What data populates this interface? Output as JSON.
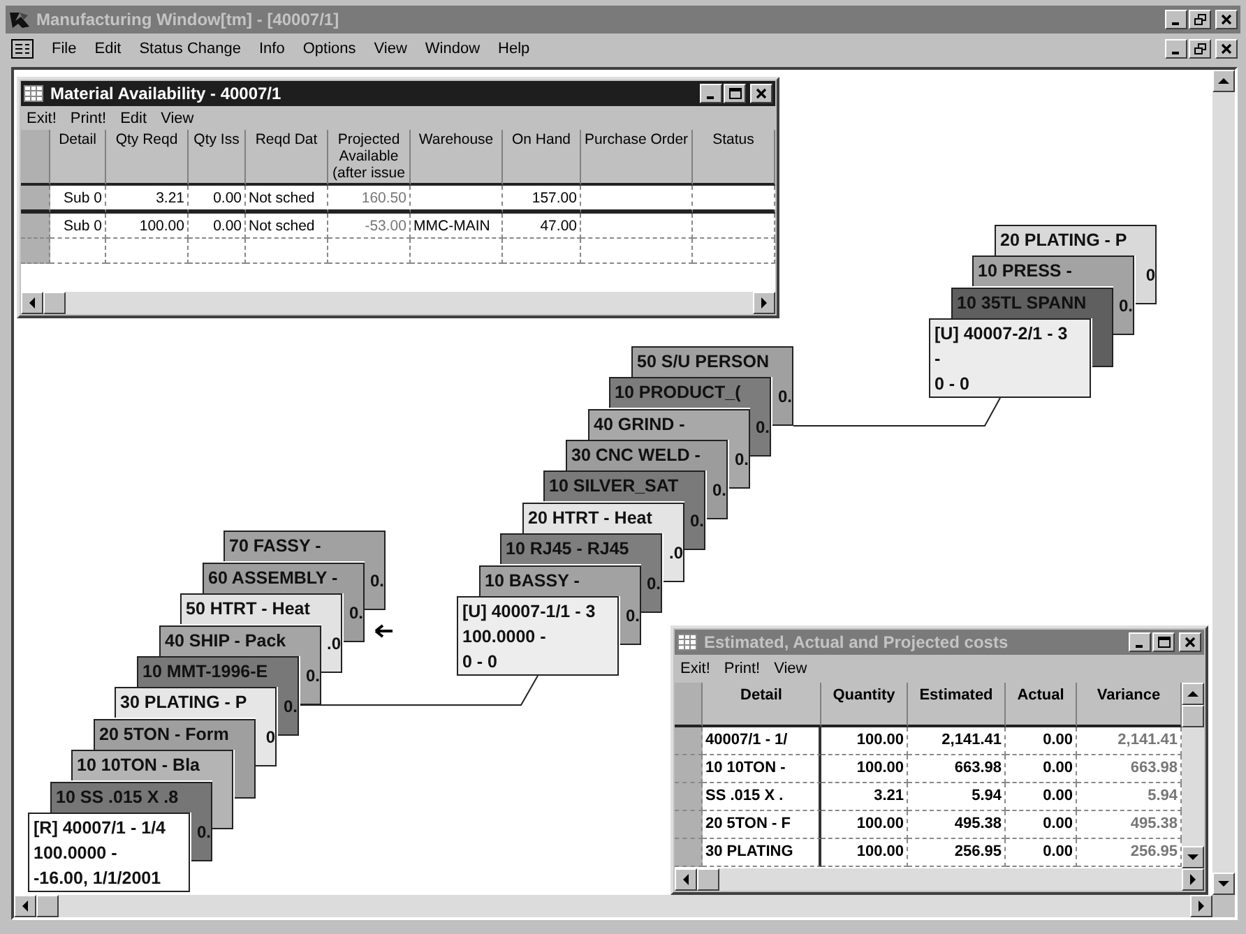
{
  "window": {
    "title": "Manufacturing Window[tm] - [40007/1]",
    "active": false
  },
  "menu": [
    "File",
    "Edit",
    "Status Change",
    "Info",
    "Options",
    "View",
    "Window",
    "Help"
  ],
  "material_window": {
    "title": "Material Availability - 40007/1",
    "active": true,
    "menu": [
      "Exit!",
      "Print!",
      "Edit",
      "View"
    ],
    "columns": [
      "Detail",
      "Qty Reqd",
      "Qty Iss",
      "Reqd Dat",
      "Projected Available (after issue",
      "Warehouse",
      "On Hand",
      "Purchase Order",
      "Status"
    ],
    "rows": [
      [
        "Sub 0",
        "3.21",
        "0.00",
        "Not sched",
        "160.50",
        null,
        "157.00"
      ],
      [
        "Sub 0",
        "100.00",
        "0.00",
        "Not sched",
        "-53.00",
        "MMC-MAIN",
        "47.00"
      ]
    ]
  },
  "stacks": [
    {
      "cards": [
        {
          "lines": [
            "20 PLATING - P"
          ],
          "tail": "0",
          "color": "#d9d9d9"
        },
        {
          "lines": [
            "10 PRESS -"
          ],
          "tail": "0.",
          "color": "#a3a3a3"
        },
        {
          "lines": [
            "10 35TL SPANN"
          ],
          "color": "#5f5f5f"
        },
        {
          "lines": [
            "[U] 40007-2/1 - 3",
            "-",
            "0 - 0"
          ],
          "color": "#ececec"
        }
      ]
    },
    {
      "cards": [
        {
          "lines": [
            "50 S/U PERSON"
          ],
          "tail": "0.",
          "color": "#a0a0a0"
        },
        {
          "lines": [
            "10 PRODUCT_("
          ],
          "tail": "0.",
          "color": "#7c7c7c"
        },
        {
          "lines": [
            "40 GRIND -"
          ],
          "tail": "0.",
          "color": "#a8a8a8"
        },
        {
          "lines": [
            "30 CNC WELD -"
          ],
          "tail": "0.",
          "color": "#9c9c9c"
        },
        {
          "lines": [
            "10 SILVER_SAT"
          ],
          "tail": "0.",
          "color": "#7a7a7a"
        },
        {
          "lines": [
            "20 HTRT - Heat"
          ],
          "tail": ".0",
          "color": "#e4e4e4"
        },
        {
          "lines": [
            "10 RJ45 - RJ45"
          ],
          "tail": "0.",
          "color": "#7e7e7e"
        },
        {
          "lines": [
            "10 BASSY -"
          ],
          "tail": "0.",
          "color": "#a2a2a2"
        },
        {
          "lines": [
            "[U] 40007-1/1 - 3",
            "100.0000 -",
            "0 - 0"
          ],
          "color": "#ededed"
        }
      ]
    },
    {
      "cards": [
        {
          "lines": [
            "70 FASSY -"
          ],
          "tail": "0.",
          "color": "#a1a1a1"
        },
        {
          "lines": [
            "60 ASSEMBLY -"
          ],
          "tail": "0.",
          "color": "#9d9d9d"
        },
        {
          "lines": [
            "50 HTRT - Heat"
          ],
          "tail": ".0",
          "color": "#e2e2e2"
        },
        {
          "lines": [
            "40 SHIP - Pack"
          ],
          "tail": "0.",
          "color": "#a5a5a5"
        },
        {
          "lines": [
            "10 MMT-1996-E"
          ],
          "tail": "0.",
          "color": "#787878"
        },
        {
          "lines": [
            "30 PLATING - P"
          ],
          "tail": "0",
          "color": "#e6e6e6"
        },
        {
          "lines": [
            "20 5TON - Form"
          ],
          "color": "#9f9f9f"
        },
        {
          "lines": [
            "10 10TON - Bla"
          ],
          "color": "#b4b4b4"
        },
        {
          "lines": [
            "10 SS .015 X .8"
          ],
          "tail": "0.",
          "color": "#767676"
        },
        {
          "lines": [
            "[R] 40007/1 - 1/4",
            "100.0000 -",
            "-16.00, 1/1/2001"
          ],
          "color": "#ffffff"
        }
      ]
    }
  ],
  "cost_window": {
    "title": "Estimated, Actual and Projected costs",
    "active": false,
    "menu": [
      "Exit!",
      "Print!",
      "View"
    ],
    "columns": [
      "Detail",
      "Quantity",
      "Estimated",
      "Actual",
      "Variance"
    ],
    "rows": [
      [
        "40007/1 - 1/",
        "100.00",
        "2,141.41",
        "0.00",
        "2,141.41"
      ],
      [
        "10 10TON -",
        "100.00",
        "663.98",
        "0.00",
        "663.98"
      ],
      [
        "SS .015 X .",
        "3.21",
        "5.94",
        "0.00",
        "5.94"
      ],
      [
        "20 5TON - F",
        "100.00",
        "495.38",
        "0.00",
        "495.38"
      ],
      [
        "30 PLATING",
        "100.00",
        "256.95",
        "0.00",
        "256.95"
      ]
    ]
  }
}
